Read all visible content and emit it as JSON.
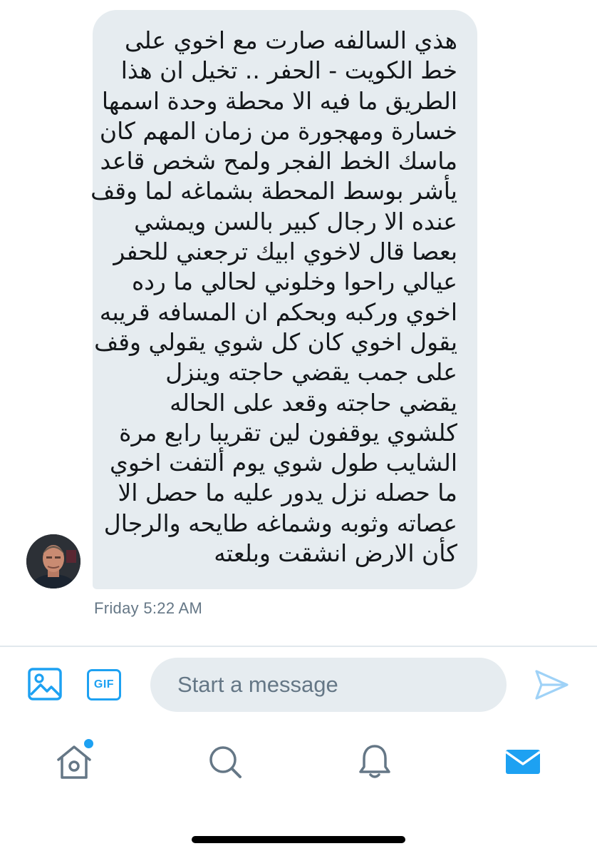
{
  "conversation": {
    "message_lines": [
      "هذي السالفه صارت مع اخوي على",
      "خط الكويت - الحفر .. تخيل ان هذا",
      "الطريق ما فيه الا محطة وحدة اسمها",
      "خسارة ومهجورة من زمان المهم كان",
      "ماسك الخط الفجر ولمح شخص قاعد",
      "يأشر بوسط المحطة بشماغه لما وقف",
      "عنده الا رجال كبير بالسن ويمشي",
      "بعصا قال لاخوي ابيك ترجعني للحفر",
      "عيالي راحوا وخلوني لحالي ما رده",
      "اخوي وركبه وبحكم ان المسافه قريبه",
      "يقول اخوي كان كل شوي يقولي وقف",
      "على جمب يقضي حاجته وينزل",
      "يقضي حاجته وقعد على الحاله",
      "كلشوي يوقفون لين تقريبا رابع مرة",
      "الشايب طول شوي يوم ألتفت اخوي",
      "ما حصله نزل يدور عليه ما حصل الا",
      "عصاته وثوبه وشماغه طايحه والرجال",
      "كأن الارض انشقت وبلعته"
    ],
    "timestamp": "Friday 5:22 AM"
  },
  "composer": {
    "placeholder": "Start a message",
    "value": "",
    "image_icon": "image-icon",
    "gif_label": "GIF",
    "send_icon": "send-icon"
  },
  "tabbar": {
    "items": [
      {
        "icon": "home-icon",
        "has_badge": true
      },
      {
        "icon": "search-icon"
      },
      {
        "icon": "bell-icon"
      },
      {
        "icon": "mail-icon",
        "active": true
      }
    ]
  },
  "colors": {
    "accent": "#1da1f2",
    "bubble": "#e6ecf0",
    "text": "#14171a",
    "muted": "#657786",
    "inactive_icon": "#657786"
  }
}
